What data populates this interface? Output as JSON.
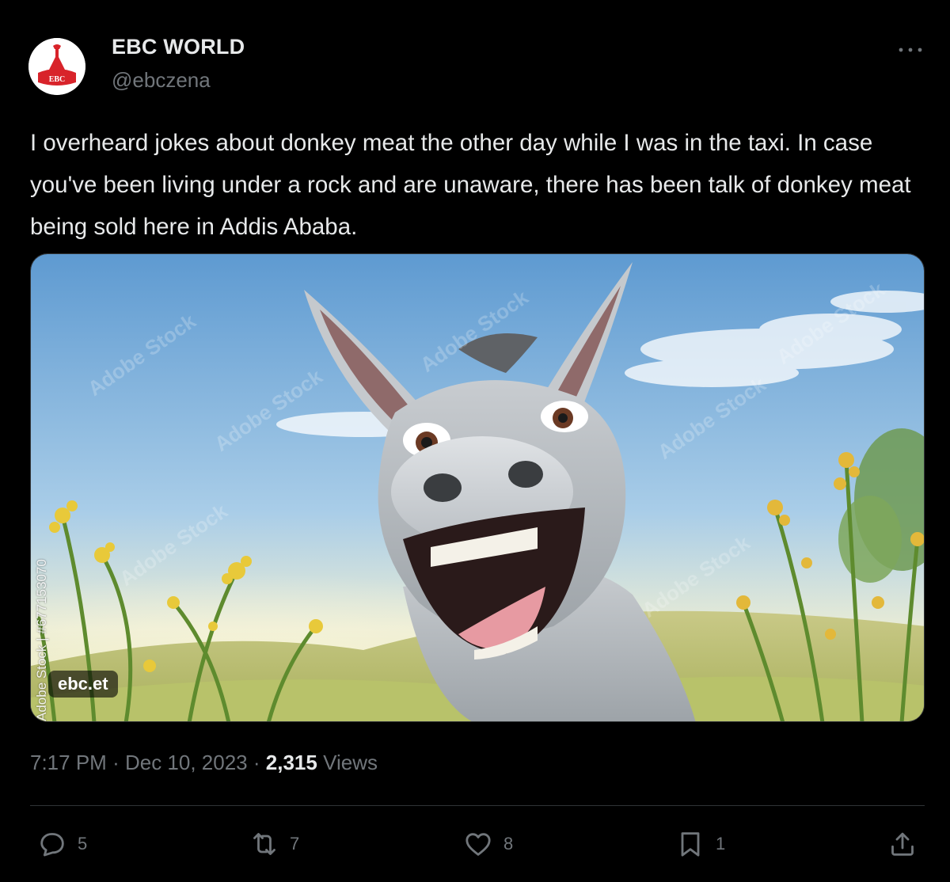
{
  "author": {
    "display_name": "EBC WORLD",
    "handle": "@ebczena",
    "avatar_text": "EBC"
  },
  "tweet": {
    "text": "I overheard jokes about donkey meat the other day while I was in the taxi. In case you've been living under a rock and are unaware, there has been talk of donkey meat being sold here in Addis Ababa."
  },
  "media": {
    "badge": "ebc.et",
    "stock_id": "Adobe Stock | #677153070",
    "watermark": "Adobe Stock",
    "description_icon": "laughing-donkey-illustration"
  },
  "meta": {
    "time": "7:17 PM",
    "date": "Dec 10, 2023",
    "separator": "·",
    "views_count": "2,315",
    "views_label": "Views"
  },
  "actions": {
    "reply_count": "5",
    "retweet_count": "7",
    "like_count": "8",
    "bookmark_count": "1"
  },
  "colors": {
    "background": "#000000",
    "text": "#e7e9ea",
    "secondary": "#71767b",
    "divider": "#2f3336",
    "brand_red": "#d8232a"
  }
}
